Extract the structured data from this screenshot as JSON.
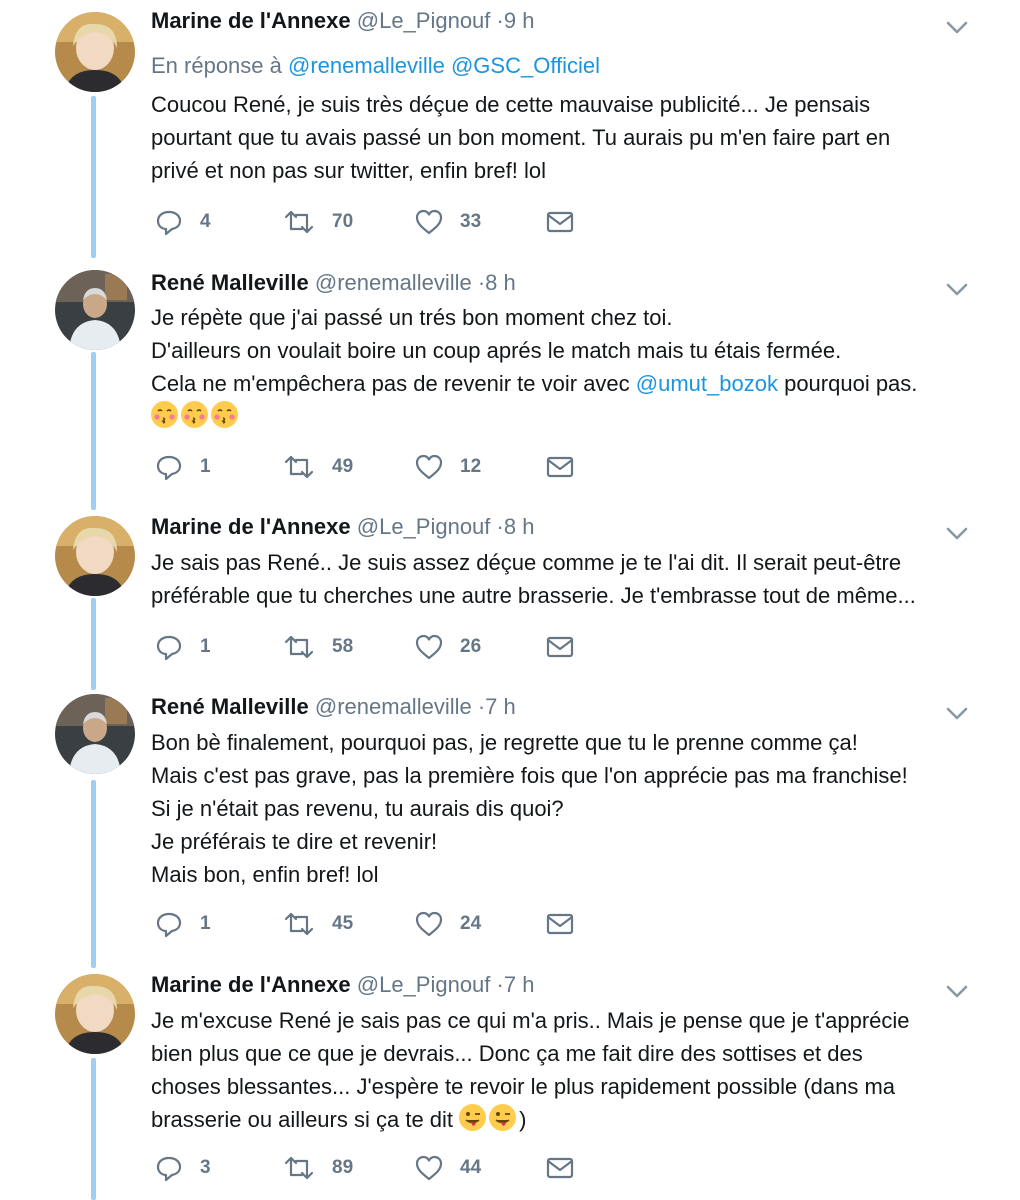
{
  "tweets": [
    {
      "author": "Marine de l'Annexe",
      "handle": "@Le_Pignouf",
      "time": "·9 h",
      "reply_prefix": "En réponse à",
      "reply_to": [
        "@renemalleville",
        "@GSC_Officiel"
      ],
      "lines": [
        "Coucou René, je suis très déçue de cette mauvaise publicité... Je pensais",
        "pourtant que tu avais passé un bon moment. Tu aurais pu m'en faire part en",
        "privé et non pas sur twitter, enfin bref! lol"
      ],
      "counts": {
        "replies": "4",
        "retweets": "70",
        "likes": "33"
      }
    },
    {
      "author": "René Malleville",
      "handle": "@renemalleville",
      "time": "·8 h",
      "lines": [
        "Je répète que j'ai passé un trés bon moment chez toi.",
        "D'ailleurs on voulait boire un coup aprés le match mais tu étais fermée."
      ],
      "line3_before": "Cela ne m'empêchera pas de revenir te voir avec ",
      "line3_mention": "@umut_bozok",
      "line3_after": " pourquoi pas.",
      "emoji_row": [
        "kissing-face-emoji",
        "kissing-face-emoji",
        "kissing-face-emoji"
      ],
      "counts": {
        "replies": "1",
        "retweets": "49",
        "likes": "12"
      }
    },
    {
      "author": "Marine de l'Annexe",
      "handle": "@Le_Pignouf",
      "time": "·8 h",
      "lines": [
        "Je sais pas René.. Je suis assez déçue comme je te l'ai dit. Il serait peut-être",
        "préférable que tu cherches une autre brasserie. Je t'embrasse tout de même..."
      ],
      "counts": {
        "replies": "1",
        "retweets": "58",
        "likes": "26"
      }
    },
    {
      "author": "René Malleville",
      "handle": "@renemalleville",
      "time": "·7 h",
      "lines": [
        "Bon bè finalement, pourquoi pas, je regrette que tu le prenne comme ça!",
        "Mais c'est pas grave, pas la première fois que l'on apprécie pas ma franchise!",
        "Si je n'était pas revenu, tu aurais dis quoi?",
        "Je préférais te dire et revenir!",
        "Mais bon, enfin bref! lol"
      ],
      "counts": {
        "replies": "1",
        "retweets": "45",
        "likes": "24"
      }
    },
    {
      "author": "Marine de l'Annexe",
      "handle": "@Le_Pignouf",
      "time": "·7 h",
      "lines": [
        "Je m'excuse René je sais pas ce qui m'a pris.. Mais je pense que je t'apprécie",
        "bien plus que ce que je devrais... Donc ça me fait dire des sottises et des",
        "choses blessantes... J'espère te revoir le plus rapidement possible (dans ma"
      ],
      "line4_before": "brasserie ou ailleurs si ça te dit ",
      "line4_emojis": [
        "winking-tongue-emoji",
        "winking-tongue-emoji"
      ],
      "line4_after": ")",
      "counts": {
        "replies": "3",
        "retweets": "89",
        "likes": "44"
      }
    }
  ],
  "colors": {
    "thread_line": "#9ecff2",
    "link": "#1b95e0",
    "muted": "#657786",
    "text": "#14171a",
    "emoji": "#ffcc4d"
  }
}
